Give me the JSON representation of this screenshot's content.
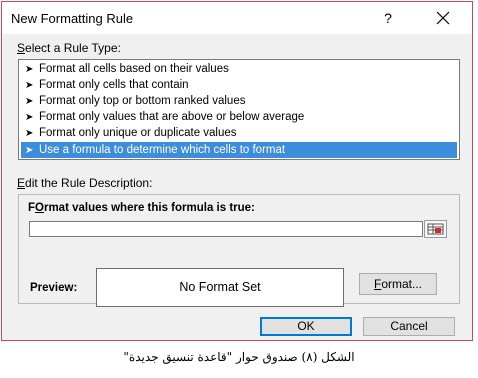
{
  "dialog": {
    "title": "New Formatting Rule",
    "help_label": "?",
    "close_label": "✕"
  },
  "rule_type": {
    "label_access_key": "S",
    "label_rest": "elect a Rule Type:",
    "items": [
      {
        "label": "Format all cells based on their values"
      },
      {
        "label": "Format only cells that contain"
      },
      {
        "label": "Format only top or bottom ranked values"
      },
      {
        "label": "Format only values that are above or below average"
      },
      {
        "label": "Format only unique or duplicate values"
      },
      {
        "label": "Use a formula to determine which cells to format",
        "selected": true
      }
    ]
  },
  "description": {
    "label_access_key": "E",
    "label_rest": "dit the Rule Description:",
    "formula_label_access_key": "O",
    "formula_label_pre": "F",
    "formula_label_rest": "rmat values where this formula is true:",
    "formula_value": "",
    "preview_label": "Preview:",
    "preview_text": "No Format Set",
    "format_button_access_key": "F",
    "format_button_rest": "ormat..."
  },
  "buttons": {
    "ok_label": "OK",
    "cancel_label": "Cancel"
  },
  "caption": "الشكل (٨) صندوق حوار \"قاعدة تنسيق جديدة\"",
  "colors": {
    "selection": "#3c8ddb",
    "default_button_border": "#0078d7",
    "dialog_border": "#c8485a"
  },
  "icons": {
    "list_arrow": "arrow-right-icon",
    "ref_button": "collapse-dialog-icon",
    "close": "close-icon"
  }
}
